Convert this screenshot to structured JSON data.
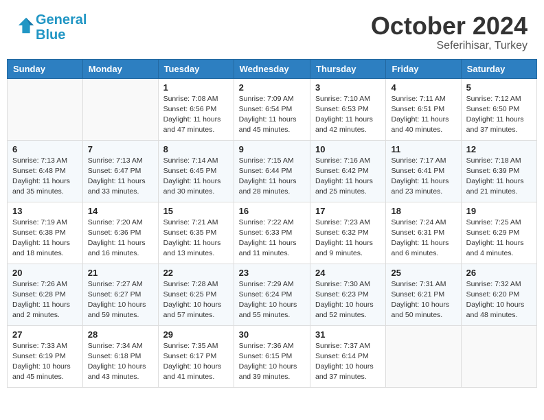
{
  "header": {
    "logo_line1": "General",
    "logo_line2": "Blue",
    "month": "October 2024",
    "location": "Seferihisar, Turkey"
  },
  "weekdays": [
    "Sunday",
    "Monday",
    "Tuesday",
    "Wednesday",
    "Thursday",
    "Friday",
    "Saturday"
  ],
  "weeks": [
    [
      {
        "day": "",
        "sunrise": "",
        "sunset": "",
        "daylight": ""
      },
      {
        "day": "",
        "sunrise": "",
        "sunset": "",
        "daylight": ""
      },
      {
        "day": "1",
        "sunrise": "Sunrise: 7:08 AM",
        "sunset": "Sunset: 6:56 PM",
        "daylight": "Daylight: 11 hours and 47 minutes."
      },
      {
        "day": "2",
        "sunrise": "Sunrise: 7:09 AM",
        "sunset": "Sunset: 6:54 PM",
        "daylight": "Daylight: 11 hours and 45 minutes."
      },
      {
        "day": "3",
        "sunrise": "Sunrise: 7:10 AM",
        "sunset": "Sunset: 6:53 PM",
        "daylight": "Daylight: 11 hours and 42 minutes."
      },
      {
        "day": "4",
        "sunrise": "Sunrise: 7:11 AM",
        "sunset": "Sunset: 6:51 PM",
        "daylight": "Daylight: 11 hours and 40 minutes."
      },
      {
        "day": "5",
        "sunrise": "Sunrise: 7:12 AM",
        "sunset": "Sunset: 6:50 PM",
        "daylight": "Daylight: 11 hours and 37 minutes."
      }
    ],
    [
      {
        "day": "6",
        "sunrise": "Sunrise: 7:13 AM",
        "sunset": "Sunset: 6:48 PM",
        "daylight": "Daylight: 11 hours and 35 minutes."
      },
      {
        "day": "7",
        "sunrise": "Sunrise: 7:13 AM",
        "sunset": "Sunset: 6:47 PM",
        "daylight": "Daylight: 11 hours and 33 minutes."
      },
      {
        "day": "8",
        "sunrise": "Sunrise: 7:14 AM",
        "sunset": "Sunset: 6:45 PM",
        "daylight": "Daylight: 11 hours and 30 minutes."
      },
      {
        "day": "9",
        "sunrise": "Sunrise: 7:15 AM",
        "sunset": "Sunset: 6:44 PM",
        "daylight": "Daylight: 11 hours and 28 minutes."
      },
      {
        "day": "10",
        "sunrise": "Sunrise: 7:16 AM",
        "sunset": "Sunset: 6:42 PM",
        "daylight": "Daylight: 11 hours and 25 minutes."
      },
      {
        "day": "11",
        "sunrise": "Sunrise: 7:17 AM",
        "sunset": "Sunset: 6:41 PM",
        "daylight": "Daylight: 11 hours and 23 minutes."
      },
      {
        "day": "12",
        "sunrise": "Sunrise: 7:18 AM",
        "sunset": "Sunset: 6:39 PM",
        "daylight": "Daylight: 11 hours and 21 minutes."
      }
    ],
    [
      {
        "day": "13",
        "sunrise": "Sunrise: 7:19 AM",
        "sunset": "Sunset: 6:38 PM",
        "daylight": "Daylight: 11 hours and 18 minutes."
      },
      {
        "day": "14",
        "sunrise": "Sunrise: 7:20 AM",
        "sunset": "Sunset: 6:36 PM",
        "daylight": "Daylight: 11 hours and 16 minutes."
      },
      {
        "day": "15",
        "sunrise": "Sunrise: 7:21 AM",
        "sunset": "Sunset: 6:35 PM",
        "daylight": "Daylight: 11 hours and 13 minutes."
      },
      {
        "day": "16",
        "sunrise": "Sunrise: 7:22 AM",
        "sunset": "Sunset: 6:33 PM",
        "daylight": "Daylight: 11 hours and 11 minutes."
      },
      {
        "day": "17",
        "sunrise": "Sunrise: 7:23 AM",
        "sunset": "Sunset: 6:32 PM",
        "daylight": "Daylight: 11 hours and 9 minutes."
      },
      {
        "day": "18",
        "sunrise": "Sunrise: 7:24 AM",
        "sunset": "Sunset: 6:31 PM",
        "daylight": "Daylight: 11 hours and 6 minutes."
      },
      {
        "day": "19",
        "sunrise": "Sunrise: 7:25 AM",
        "sunset": "Sunset: 6:29 PM",
        "daylight": "Daylight: 11 hours and 4 minutes."
      }
    ],
    [
      {
        "day": "20",
        "sunrise": "Sunrise: 7:26 AM",
        "sunset": "Sunset: 6:28 PM",
        "daylight": "Daylight: 11 hours and 2 minutes."
      },
      {
        "day": "21",
        "sunrise": "Sunrise: 7:27 AM",
        "sunset": "Sunset: 6:27 PM",
        "daylight": "Daylight: 10 hours and 59 minutes."
      },
      {
        "day": "22",
        "sunrise": "Sunrise: 7:28 AM",
        "sunset": "Sunset: 6:25 PM",
        "daylight": "Daylight: 10 hours and 57 minutes."
      },
      {
        "day": "23",
        "sunrise": "Sunrise: 7:29 AM",
        "sunset": "Sunset: 6:24 PM",
        "daylight": "Daylight: 10 hours and 55 minutes."
      },
      {
        "day": "24",
        "sunrise": "Sunrise: 7:30 AM",
        "sunset": "Sunset: 6:23 PM",
        "daylight": "Daylight: 10 hours and 52 minutes."
      },
      {
        "day": "25",
        "sunrise": "Sunrise: 7:31 AM",
        "sunset": "Sunset: 6:21 PM",
        "daylight": "Daylight: 10 hours and 50 minutes."
      },
      {
        "day": "26",
        "sunrise": "Sunrise: 7:32 AM",
        "sunset": "Sunset: 6:20 PM",
        "daylight": "Daylight: 10 hours and 48 minutes."
      }
    ],
    [
      {
        "day": "27",
        "sunrise": "Sunrise: 7:33 AM",
        "sunset": "Sunset: 6:19 PM",
        "daylight": "Daylight: 10 hours and 45 minutes."
      },
      {
        "day": "28",
        "sunrise": "Sunrise: 7:34 AM",
        "sunset": "Sunset: 6:18 PM",
        "daylight": "Daylight: 10 hours and 43 minutes."
      },
      {
        "day": "29",
        "sunrise": "Sunrise: 7:35 AM",
        "sunset": "Sunset: 6:17 PM",
        "daylight": "Daylight: 10 hours and 41 minutes."
      },
      {
        "day": "30",
        "sunrise": "Sunrise: 7:36 AM",
        "sunset": "Sunset: 6:15 PM",
        "daylight": "Daylight: 10 hours and 39 minutes."
      },
      {
        "day": "31",
        "sunrise": "Sunrise: 7:37 AM",
        "sunset": "Sunset: 6:14 PM",
        "daylight": "Daylight: 10 hours and 37 minutes."
      },
      {
        "day": "",
        "sunrise": "",
        "sunset": "",
        "daylight": ""
      },
      {
        "day": "",
        "sunrise": "",
        "sunset": "",
        "daylight": ""
      }
    ]
  ]
}
